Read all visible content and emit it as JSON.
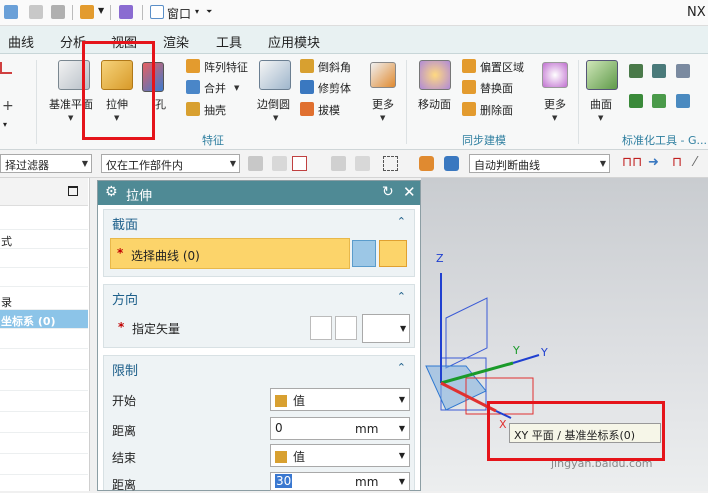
{
  "titlebar": {
    "window_menu": "窗口",
    "app_name": "NX"
  },
  "menubar": {
    "items": [
      "曲线",
      "分析",
      "视图",
      "渲染",
      "工具",
      "应用模块"
    ]
  },
  "ribbon": {
    "left_partial": {
      "datum_plane": "基准平面"
    },
    "feature_group": {
      "extrude": "拉伸",
      "hole": "孔",
      "pattern_feature": "阵列特征",
      "unite": "合并",
      "shell": "抽壳",
      "edge_blend": "边倒圆",
      "chamfer": "倒斜角",
      "trim_body": "修剪体",
      "draft": "拔模",
      "more": "更多",
      "group_label": "特征"
    },
    "sync_group": {
      "move_face": "移动面",
      "offset_region": "偏置区域",
      "replace_face": "替换面",
      "delete_face": "删除面",
      "more": "更多",
      "group_label": "同步建模"
    },
    "surface_group": {
      "surface": "曲面",
      "group_label": "标准化工具 - G..."
    }
  },
  "filterbar": {
    "type_filter": "择过滤器",
    "scope": "仅在工作部件内",
    "curve_rule": "自动判断曲线"
  },
  "navigator": {
    "rows": [
      "",
      "式",
      "",
      "",
      "录",
      "坐标系 (0)",
      "",
      "",
      "",
      "",
      "",
      "",
      ""
    ]
  },
  "dialog": {
    "title": "拉伸",
    "section": {
      "label": "截面",
      "select_curve": "选择曲线 (0)"
    },
    "direction": {
      "label": "方向",
      "specify_vector": "指定矢量"
    },
    "limits": {
      "label": "限制",
      "start_label": "开始",
      "start_value": "值",
      "distance_label": "距离",
      "distance_value": "0",
      "distance_unit": "mm",
      "end_label": "结束",
      "end_value": "值",
      "end_distance_label": "距离",
      "end_distance_value": "30",
      "end_distance_unit": "mm"
    }
  },
  "graphics": {
    "axis_z": "Z",
    "axis_y": "Y",
    "axis_x": "X",
    "tooltip": "XY 平面 / 基准坐标系(0)",
    "watermark": "jingyan.baidu.com"
  },
  "colors": {
    "accent_red": "#e5141a",
    "dialog_header": "#4f8a95",
    "select_highlight": "#fcd46a"
  }
}
